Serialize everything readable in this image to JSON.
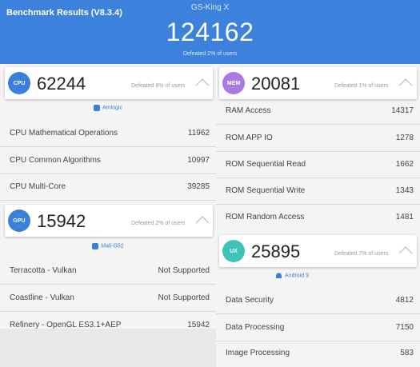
{
  "header": {
    "title": "Benchmark Results (V8.3.4)",
    "device": "GS-King X",
    "total_score": "124162",
    "defeated": "Defeated 2% of users",
    "bg_color": "#3c82dc"
  },
  "cpu": {
    "badge": "CPU",
    "badge_color": "#3a7fd8",
    "score": "62244",
    "defeated": "Defeated 8% of users",
    "chip_icon": "chip-icon",
    "chip": "Amlogic",
    "rows": [
      {
        "label": "CPU Mathematical Operations",
        "value": "11962"
      },
      {
        "label": "CPU Common Algorithms",
        "value": "10997"
      },
      {
        "label": "CPU Multi-Core",
        "value": "39285"
      }
    ]
  },
  "gpu": {
    "badge": "GPU",
    "badge_color": "#3a7fd8",
    "score": "15942",
    "defeated": "Defeated 2% of users",
    "chip_icon": "chip-icon",
    "chip": "Mali-G52",
    "rows": [
      {
        "label": "Terracotta - Vulkan",
        "value": "Not Supported"
      },
      {
        "label": "Coastline - Vulkan",
        "value": "Not Supported"
      },
      {
        "label": "Refinery - OpenGL ES3.1+AEP",
        "value": "15942"
      }
    ]
  },
  "mem": {
    "badge": "MEM",
    "badge_color": "#a97be0",
    "score": "20081",
    "defeated": "Defeated 1% of users",
    "rows": [
      {
        "label": "RAM Access",
        "value": "14317"
      },
      {
        "label": "ROM APP IO",
        "value": "1278"
      },
      {
        "label": "ROM Sequential Read",
        "value": "1662"
      },
      {
        "label": "ROM Sequential Write",
        "value": "1343"
      },
      {
        "label": "ROM Random Access",
        "value": "1481"
      }
    ]
  },
  "ux": {
    "badge": "UX",
    "badge_color": "#3fc3b8",
    "score": "25895",
    "defeated": "Defeated 7% of users",
    "chip_icon": "android-icon",
    "chip": "Android 9",
    "rows": [
      {
        "label": "Data Security",
        "value": "4812"
      },
      {
        "label": "Data Processing",
        "value": "7150"
      },
      {
        "label": "Image Processing",
        "value": "583"
      }
    ]
  }
}
